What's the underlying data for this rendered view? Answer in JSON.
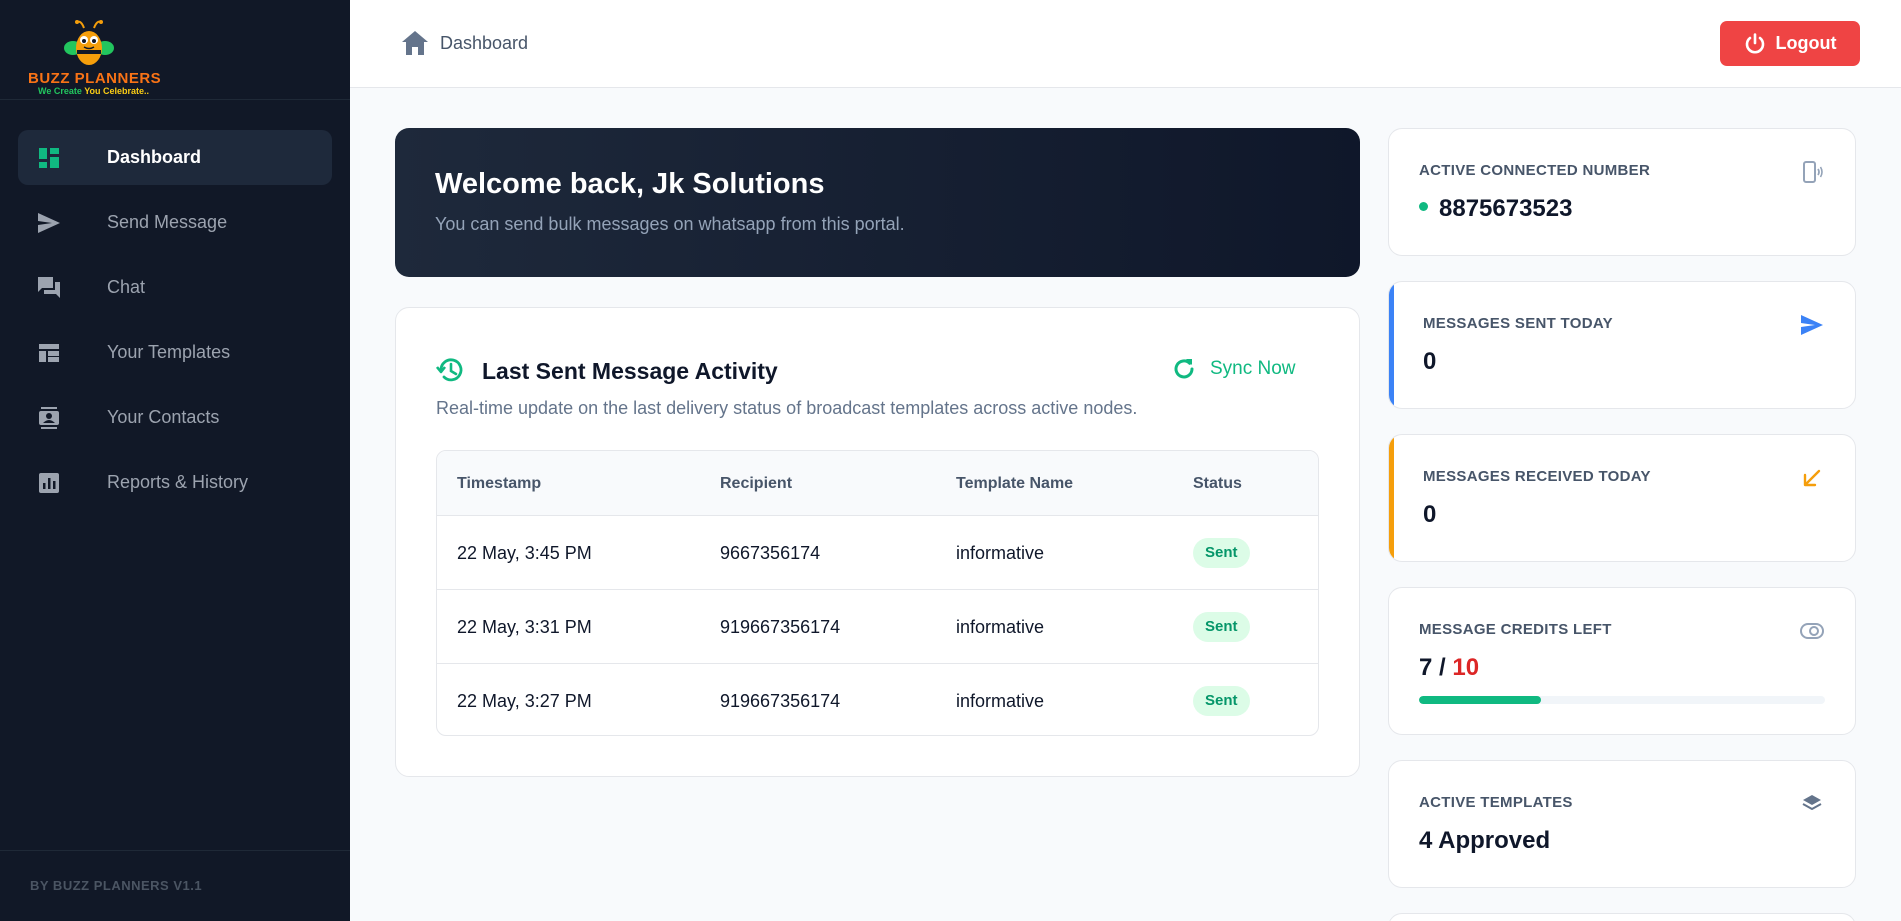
{
  "brand": {
    "name": "BUZZ PLANNERS",
    "tagline_part1": "We Create",
    "tagline_part2": "You Celebrate.."
  },
  "sidebar": {
    "items": [
      {
        "label": "Dashboard",
        "icon": "dashboard-icon",
        "active": true
      },
      {
        "label": "Send Message",
        "icon": "send-icon"
      },
      {
        "label": "Chat",
        "icon": "chat-icon"
      },
      {
        "label": "Your Templates",
        "icon": "templates-icon"
      },
      {
        "label": "Your Contacts",
        "icon": "contacts-icon"
      },
      {
        "label": "Reports & History",
        "icon": "reports-icon"
      }
    ],
    "footer": "BY BUZZ PLANNERS V1.1"
  },
  "topbar": {
    "breadcrumb": "Dashboard",
    "logout_label": "Logout"
  },
  "welcome": {
    "title": "Welcome back, Jk Solutions",
    "subtitle": "You can send bulk messages on whatsapp from this portal."
  },
  "activity": {
    "title": "Last Sent Message Activity",
    "subtitle": "Real-time update on the last delivery status of broadcast templates across active nodes.",
    "sync_label": "Sync Now",
    "columns": [
      "Timestamp",
      "Recipient",
      "Template Name",
      "Status"
    ],
    "rows": [
      {
        "timestamp": "22 May, 3:45 PM",
        "recipient": "9667356174",
        "template": "informative",
        "status": "Sent"
      },
      {
        "timestamp": "22 May, 3:31 PM",
        "recipient": "919667356174",
        "template": "informative",
        "status": "Sent"
      },
      {
        "timestamp": "22 May, 3:27 PM",
        "recipient": "919667356174",
        "template": "informative",
        "status": "Sent"
      }
    ]
  },
  "stats": {
    "connected": {
      "label": "ACTIVE CONNECTED NUMBER",
      "value": "8875673523"
    },
    "sent": {
      "label": "MESSAGES SENT TODAY",
      "value": "0"
    },
    "received": {
      "label": "MESSAGES RECEIVED TODAY",
      "value": "0"
    },
    "credits": {
      "label": "MESSAGE CREDITS LEFT",
      "used": "7",
      "separator": " / ",
      "total": "10",
      "fraction": 0.3
    },
    "templates": {
      "label": "ACTIVE TEMPLATES",
      "value": "4 Approved"
    }
  },
  "colors": {
    "sidebar_bg": "#111827",
    "accent_green": "#10b981",
    "logout_red": "#ef4444",
    "sent_blue": "#3b82f6",
    "received_orange": "#f59e0b"
  }
}
